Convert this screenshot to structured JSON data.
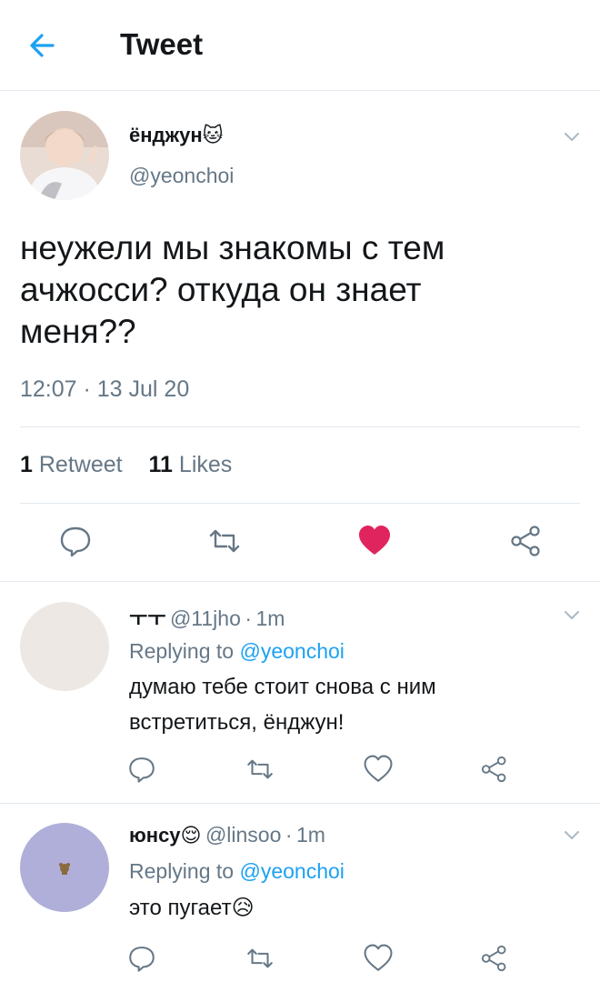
{
  "header": {
    "title": "Tweet"
  },
  "tweet": {
    "author_name": "ёнджун",
    "author_emoji": "🐱",
    "handle": "@yeonchoi",
    "text": "неужели мы знакомы с тем\nачжосси? откуда он знает\nменя??",
    "time": "12:07 · 13 Jul 20",
    "retweets_count": "1",
    "retweets_label": "Retweet",
    "likes_count": "11",
    "likes_label": "Likes",
    "liked": true
  },
  "colors": {
    "accent": "#1da1f2",
    "like": "#e0245e",
    "muted": "#657786",
    "divider": "#e1e8ed"
  },
  "replies": [
    {
      "name": "ㅜㅜ",
      "handle": "@11jho",
      "time": "1m",
      "replying_prefix": "Replying to",
      "replying_to": "@yeonchoi",
      "text": "думаю тебе стоит снова с ним\nвстретиться, ёнджун!"
    },
    {
      "name": "юнсу",
      "name_emoji": "😌",
      "handle": "@linsoo",
      "time": "1m",
      "replying_prefix": "Replying to",
      "replying_to": "@yeonchoi",
      "text": "это пугает",
      "text_emoji": "😥"
    }
  ]
}
